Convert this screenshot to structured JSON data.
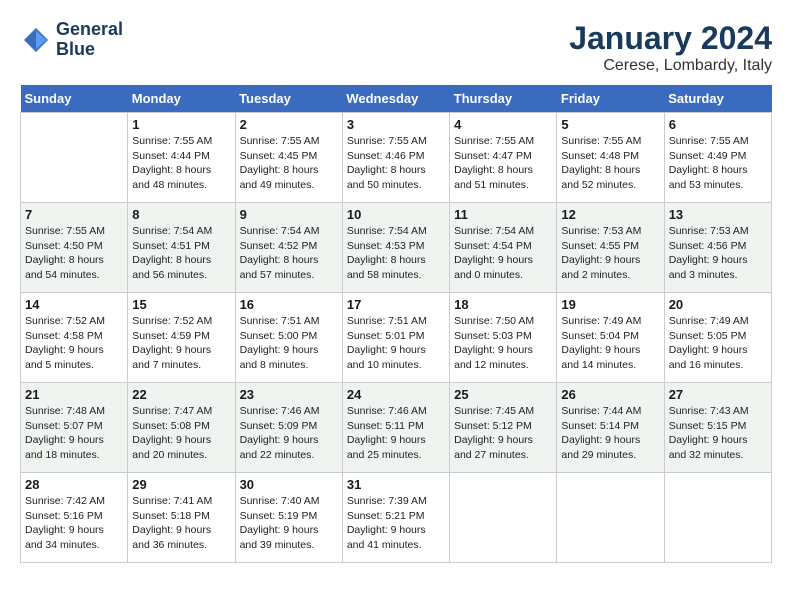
{
  "header": {
    "logo_line1": "General",
    "logo_line2": "Blue",
    "month": "January 2024",
    "location": "Cerese, Lombardy, Italy"
  },
  "days_of_week": [
    "Sunday",
    "Monday",
    "Tuesday",
    "Wednesday",
    "Thursday",
    "Friday",
    "Saturday"
  ],
  "weeks": [
    [
      {
        "day": "",
        "sunrise": "",
        "sunset": "",
        "daylight": ""
      },
      {
        "day": "1",
        "sunrise": "Sunrise: 7:55 AM",
        "sunset": "Sunset: 4:44 PM",
        "daylight": "Daylight: 8 hours and 48 minutes."
      },
      {
        "day": "2",
        "sunrise": "Sunrise: 7:55 AM",
        "sunset": "Sunset: 4:45 PM",
        "daylight": "Daylight: 8 hours and 49 minutes."
      },
      {
        "day": "3",
        "sunrise": "Sunrise: 7:55 AM",
        "sunset": "Sunset: 4:46 PM",
        "daylight": "Daylight: 8 hours and 50 minutes."
      },
      {
        "day": "4",
        "sunrise": "Sunrise: 7:55 AM",
        "sunset": "Sunset: 4:47 PM",
        "daylight": "Daylight: 8 hours and 51 minutes."
      },
      {
        "day": "5",
        "sunrise": "Sunrise: 7:55 AM",
        "sunset": "Sunset: 4:48 PM",
        "daylight": "Daylight: 8 hours and 52 minutes."
      },
      {
        "day": "6",
        "sunrise": "Sunrise: 7:55 AM",
        "sunset": "Sunset: 4:49 PM",
        "daylight": "Daylight: 8 hours and 53 minutes."
      }
    ],
    [
      {
        "day": "7",
        "sunrise": "Sunrise: 7:55 AM",
        "sunset": "Sunset: 4:50 PM",
        "daylight": "Daylight: 8 hours and 54 minutes."
      },
      {
        "day": "8",
        "sunrise": "Sunrise: 7:54 AM",
        "sunset": "Sunset: 4:51 PM",
        "daylight": "Daylight: 8 hours and 56 minutes."
      },
      {
        "day": "9",
        "sunrise": "Sunrise: 7:54 AM",
        "sunset": "Sunset: 4:52 PM",
        "daylight": "Daylight: 8 hours and 57 minutes."
      },
      {
        "day": "10",
        "sunrise": "Sunrise: 7:54 AM",
        "sunset": "Sunset: 4:53 PM",
        "daylight": "Daylight: 8 hours and 58 minutes."
      },
      {
        "day": "11",
        "sunrise": "Sunrise: 7:54 AM",
        "sunset": "Sunset: 4:54 PM",
        "daylight": "Daylight: 9 hours and 0 minutes."
      },
      {
        "day": "12",
        "sunrise": "Sunrise: 7:53 AM",
        "sunset": "Sunset: 4:55 PM",
        "daylight": "Daylight: 9 hours and 2 minutes."
      },
      {
        "day": "13",
        "sunrise": "Sunrise: 7:53 AM",
        "sunset": "Sunset: 4:56 PM",
        "daylight": "Daylight: 9 hours and 3 minutes."
      }
    ],
    [
      {
        "day": "14",
        "sunrise": "Sunrise: 7:52 AM",
        "sunset": "Sunset: 4:58 PM",
        "daylight": "Daylight: 9 hours and 5 minutes."
      },
      {
        "day": "15",
        "sunrise": "Sunrise: 7:52 AM",
        "sunset": "Sunset: 4:59 PM",
        "daylight": "Daylight: 9 hours and 7 minutes."
      },
      {
        "day": "16",
        "sunrise": "Sunrise: 7:51 AM",
        "sunset": "Sunset: 5:00 PM",
        "daylight": "Daylight: 9 hours and 8 minutes."
      },
      {
        "day": "17",
        "sunrise": "Sunrise: 7:51 AM",
        "sunset": "Sunset: 5:01 PM",
        "daylight": "Daylight: 9 hours and 10 minutes."
      },
      {
        "day": "18",
        "sunrise": "Sunrise: 7:50 AM",
        "sunset": "Sunset: 5:03 PM",
        "daylight": "Daylight: 9 hours and 12 minutes."
      },
      {
        "day": "19",
        "sunrise": "Sunrise: 7:49 AM",
        "sunset": "Sunset: 5:04 PM",
        "daylight": "Daylight: 9 hours and 14 minutes."
      },
      {
        "day": "20",
        "sunrise": "Sunrise: 7:49 AM",
        "sunset": "Sunset: 5:05 PM",
        "daylight": "Daylight: 9 hours and 16 minutes."
      }
    ],
    [
      {
        "day": "21",
        "sunrise": "Sunrise: 7:48 AM",
        "sunset": "Sunset: 5:07 PM",
        "daylight": "Daylight: 9 hours and 18 minutes."
      },
      {
        "day": "22",
        "sunrise": "Sunrise: 7:47 AM",
        "sunset": "Sunset: 5:08 PM",
        "daylight": "Daylight: 9 hours and 20 minutes."
      },
      {
        "day": "23",
        "sunrise": "Sunrise: 7:46 AM",
        "sunset": "Sunset: 5:09 PM",
        "daylight": "Daylight: 9 hours and 22 minutes."
      },
      {
        "day": "24",
        "sunrise": "Sunrise: 7:46 AM",
        "sunset": "Sunset: 5:11 PM",
        "daylight": "Daylight: 9 hours and 25 minutes."
      },
      {
        "day": "25",
        "sunrise": "Sunrise: 7:45 AM",
        "sunset": "Sunset: 5:12 PM",
        "daylight": "Daylight: 9 hours and 27 minutes."
      },
      {
        "day": "26",
        "sunrise": "Sunrise: 7:44 AM",
        "sunset": "Sunset: 5:14 PM",
        "daylight": "Daylight: 9 hours and 29 minutes."
      },
      {
        "day": "27",
        "sunrise": "Sunrise: 7:43 AM",
        "sunset": "Sunset: 5:15 PM",
        "daylight": "Daylight: 9 hours and 32 minutes."
      }
    ],
    [
      {
        "day": "28",
        "sunrise": "Sunrise: 7:42 AM",
        "sunset": "Sunset: 5:16 PM",
        "daylight": "Daylight: 9 hours and 34 minutes."
      },
      {
        "day": "29",
        "sunrise": "Sunrise: 7:41 AM",
        "sunset": "Sunset: 5:18 PM",
        "daylight": "Daylight: 9 hours and 36 minutes."
      },
      {
        "day": "30",
        "sunrise": "Sunrise: 7:40 AM",
        "sunset": "Sunset: 5:19 PM",
        "daylight": "Daylight: 9 hours and 39 minutes."
      },
      {
        "day": "31",
        "sunrise": "Sunrise: 7:39 AM",
        "sunset": "Sunset: 5:21 PM",
        "daylight": "Daylight: 9 hours and 41 minutes."
      },
      {
        "day": "",
        "sunrise": "",
        "sunset": "",
        "daylight": ""
      },
      {
        "day": "",
        "sunrise": "",
        "sunset": "",
        "daylight": ""
      },
      {
        "day": "",
        "sunrise": "",
        "sunset": "",
        "daylight": ""
      }
    ]
  ]
}
